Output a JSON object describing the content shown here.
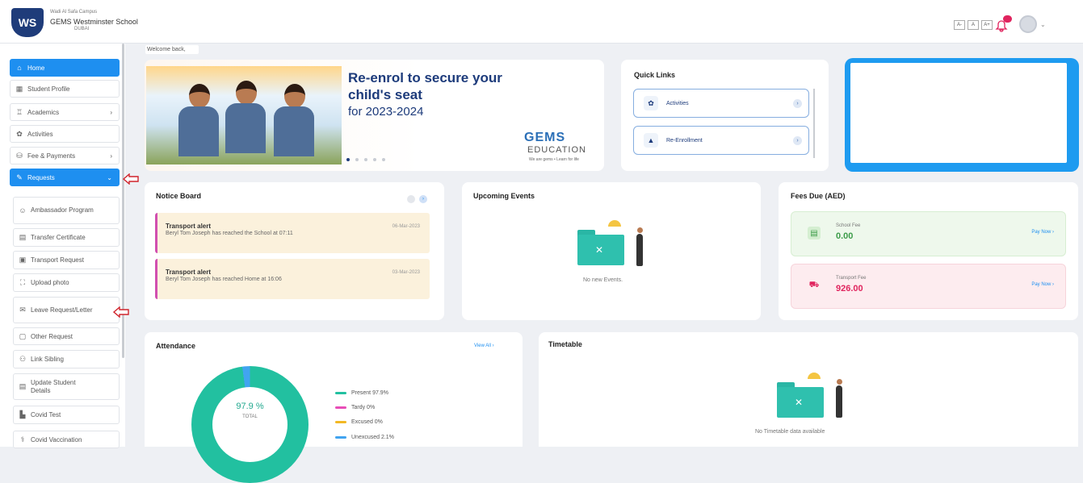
{
  "header": {
    "school_small": "Wadi Al Safa Campus",
    "school_name": "GEMS Westminster School",
    "school_sub": "DUBAI",
    "logo_text": "WS",
    "font_sizes": [
      "A-",
      "A",
      "A+"
    ]
  },
  "sidebar": {
    "items": [
      {
        "label": "Home",
        "icon": "home-icon"
      },
      {
        "label": "Student Profile",
        "icon": "student-icon"
      },
      {
        "label": "Academics",
        "icon": "academics-icon"
      },
      {
        "label": "Activities",
        "icon": "activities-icon"
      },
      {
        "label": "Fee & Payments",
        "icon": "fee-icon"
      },
      {
        "label": "Requests",
        "icon": "requests-icon"
      }
    ],
    "sub_items": [
      {
        "label": "Ambassador Program"
      },
      {
        "label": "Transfer Certificate"
      },
      {
        "label": "Transport Request"
      },
      {
        "label": "Upload photo"
      },
      {
        "label": "Leave Request/Letter"
      },
      {
        "label": "Other Request"
      },
      {
        "label": "Link Sibling"
      },
      {
        "label": "Update Student Details"
      },
      {
        "label": "Covid Test"
      },
      {
        "label": "Covid Vaccination"
      }
    ]
  },
  "main": {
    "welcome": "Welcome back,",
    "banner": {
      "headline": "Re-enrol to secure your child's seat",
      "year": "for 2023-2024",
      "brand": "GEMS",
      "brand_sub": "EDUCATION",
      "tagline": "We are gems • Learn for life"
    },
    "quick_links": {
      "title": "Quick Links",
      "items": [
        {
          "label": "Activities"
        },
        {
          "label": "Re-Enrollment"
        }
      ]
    },
    "notice_board": {
      "title": "Notice Board",
      "items": [
        {
          "title": "Transport alert",
          "desc": "Beryl Tom Joseph has reached the School at 07:11",
          "date": "06-Mar-2023"
        },
        {
          "title": "Transport alert",
          "desc": "Beryl Tom Joseph has reached Home at 16:06",
          "date": "03-Mar-2023"
        }
      ]
    },
    "events": {
      "title": "Upcoming Events",
      "empty": "No new Events."
    },
    "fees": {
      "title": "Fees Due (AED)",
      "items": [
        {
          "label": "School Fee",
          "amount": "0.00",
          "action": "Pay Now"
        },
        {
          "label": "Transport Fee",
          "amount": "926.00",
          "action": "Pay Now"
        }
      ]
    },
    "attendance": {
      "title": "Attendance",
      "view_all": "View All",
      "total_value": "97.9 %",
      "total_label": "TOTAL",
      "present_fraction": 0.979,
      "legend": [
        {
          "label": "Present 97.9%",
          "color": "#22c0a0"
        },
        {
          "label": "Tardy 0%",
          "color": "#e84db7"
        },
        {
          "label": "Excused 0%",
          "color": "#f2b824"
        },
        {
          "label": "Unexcused 2.1%",
          "color": "#41a4f0"
        }
      ]
    },
    "timetable": {
      "title": "Timetable",
      "empty": "No Timetable data available"
    }
  },
  "colors": {
    "accent": "#1e8ff0",
    "brand_navy": "#1d3b7b",
    "present": "#22c0a0"
  }
}
